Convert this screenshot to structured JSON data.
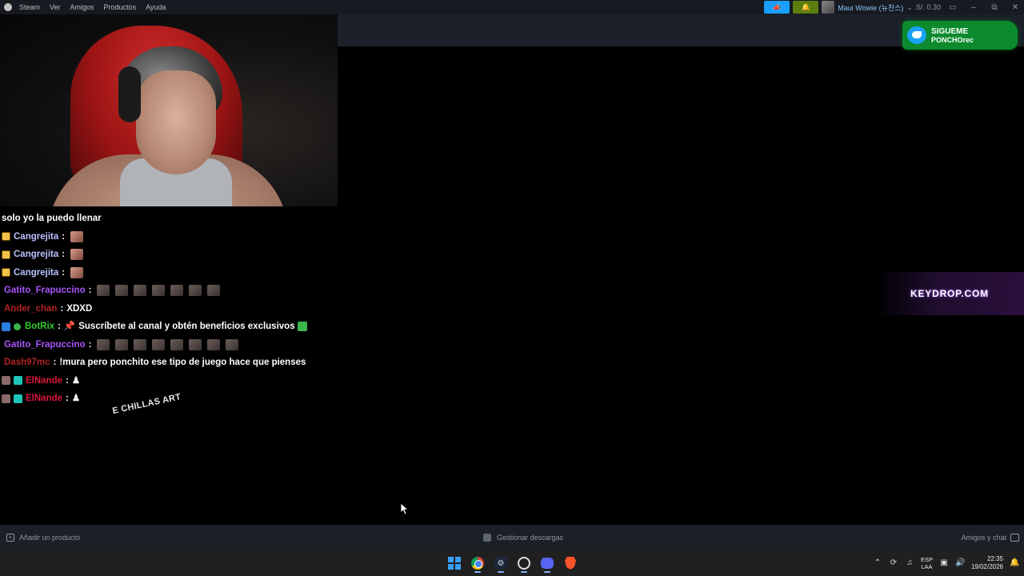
{
  "menubar": {
    "items": [
      "Steam",
      "Ver",
      "Amigos",
      "Productos",
      "Ayuda"
    ]
  },
  "account": {
    "username": "Maui Wowie (뉴찬스)",
    "balance": "S/. 0.30"
  },
  "chat": {
    "partial_top": "solo yo la puedo llenar",
    "messages": [
      {
        "user": "Cangrejita",
        "text": "",
        "color": "#b9c2ff"
      },
      {
        "user": "Cangrejita",
        "text": "",
        "color": "#b9c2ff"
      },
      {
        "user": "Cangrejita",
        "text": "",
        "color": "#b9c2ff"
      },
      {
        "user": "Gatito_Frapuccino",
        "text": "",
        "color": "#a855f7"
      },
      {
        "user": "Ander_chan",
        "text": "XDXD",
        "color": "#b22222"
      },
      {
        "user": "BotRix",
        "text": "Suscríbete al canal y obtén beneficios exclusivos",
        "color": "#32cd32"
      },
      {
        "user": "Gatito_Frapuccino",
        "text": "",
        "color": "#a855f7"
      },
      {
        "user": "Dash97mc",
        "text": "!mura pero ponchito ese tipo de juego hace que pienses",
        "color": "#b22222"
      },
      {
        "user": "ElNande",
        "text": "",
        "color": "#dc143c"
      },
      {
        "user": "ElNande",
        "text": "",
        "color": "#dc143c"
      }
    ],
    "separator": ":"
  },
  "overlay": {
    "chillas_text": "E CHILLAS ART",
    "twitter_line1": "SIGUEME",
    "twitter_line2": "PONCHOrec",
    "keydrop": "KEYDROP.COM"
  },
  "bottombar": {
    "add_product": "Añadir un producto",
    "manage_downloads": "Gestionar descargas",
    "friends_chat": "Amigos y chat"
  },
  "taskbar": {
    "lang_line1": "ESP",
    "lang_line2": "LAA",
    "time": "22:35",
    "date": "19/02/2026"
  }
}
